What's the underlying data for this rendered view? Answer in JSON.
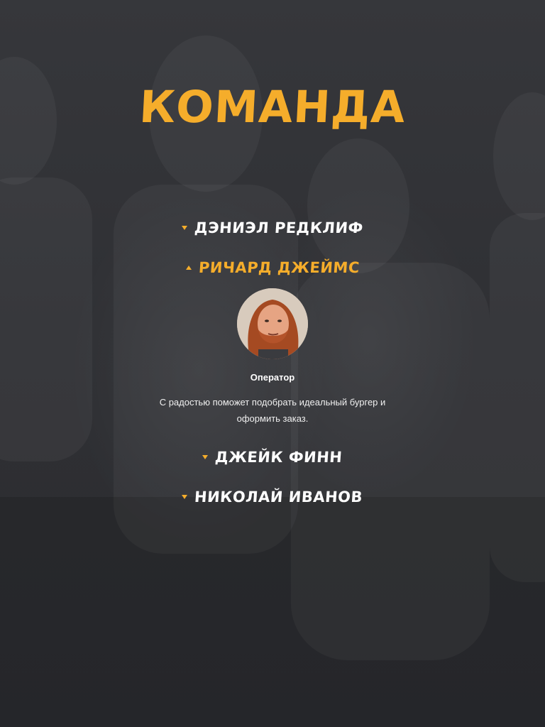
{
  "section": {
    "title": "КОМАНДА"
  },
  "team": [
    {
      "name": "ДЭНИЭЛ РЕДКЛИФ",
      "expanded": false
    },
    {
      "name": "РИЧАРД ДЖЕЙМС",
      "expanded": true,
      "role": "Оператор",
      "description": "С радостью поможет подобрать идеальный бургер и оформить заказ."
    },
    {
      "name": "ДЖЕЙК ФИНН",
      "expanded": false
    },
    {
      "name": "НИКОЛАЙ ИВАНОВ",
      "expanded": false
    }
  ],
  "colors": {
    "accent": "#f5ad2b",
    "background": "#2e2f33",
    "text": "#ffffff"
  },
  "icons": {
    "collapsed": "triangle-down-icon",
    "expanded": "triangle-up-icon"
  }
}
